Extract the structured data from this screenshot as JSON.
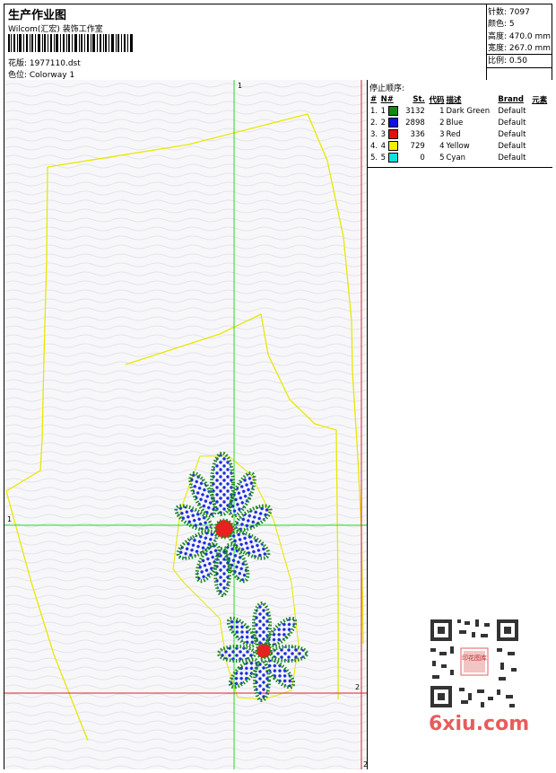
{
  "header": {
    "title": "生产作业图",
    "company": "Wilcom(汇宏) 装饰工作室",
    "design_file": "花版: 1977110.dst",
    "colorway": "色位: Colorway 1"
  },
  "info": {
    "stitches": "针数: 7097",
    "colors": "颜色: 5",
    "height": "高度: 470.0 mm",
    "width": "宽度: 267.0 mm",
    "scale": "比例: 0.50"
  },
  "stop_sequence": {
    "title": "停止顺序:",
    "headers": [
      "#",
      "N#",
      "St.",
      "代码",
      "描述",
      "Brand",
      "元素"
    ],
    "rows": [
      {
        "idx": "1.",
        "n": "1",
        "color": "#108a10",
        "st": "3132",
        "code": "1",
        "desc": "Dark Green",
        "brand": "Default"
      },
      {
        "idx": "2.",
        "n": "2",
        "color": "#1010e0",
        "st": "2898",
        "code": "2",
        "desc": "Blue",
        "brand": "Default"
      },
      {
        "idx": "3.",
        "n": "3",
        "color": "#e01010",
        "st": "336",
        "code": "3",
        "desc": "Red",
        "brand": "Default"
      },
      {
        "idx": "4.",
        "n": "4",
        "color": "#f0f000",
        "st": "729",
        "code": "4",
        "desc": "Yellow",
        "brand": "Default"
      },
      {
        "idx": "5.",
        "n": "5",
        "color": "#10e0e0",
        "st": "0",
        "code": "5",
        "desc": "Cyan",
        "brand": "Default"
      }
    ]
  },
  "canvas": {
    "axis_label_top": "1",
    "axis_label_left": "1",
    "axis_label_right": "2",
    "axis_label_bottom": "2"
  },
  "watermark": "6xiu.com",
  "qr_center_text": "印花图库"
}
